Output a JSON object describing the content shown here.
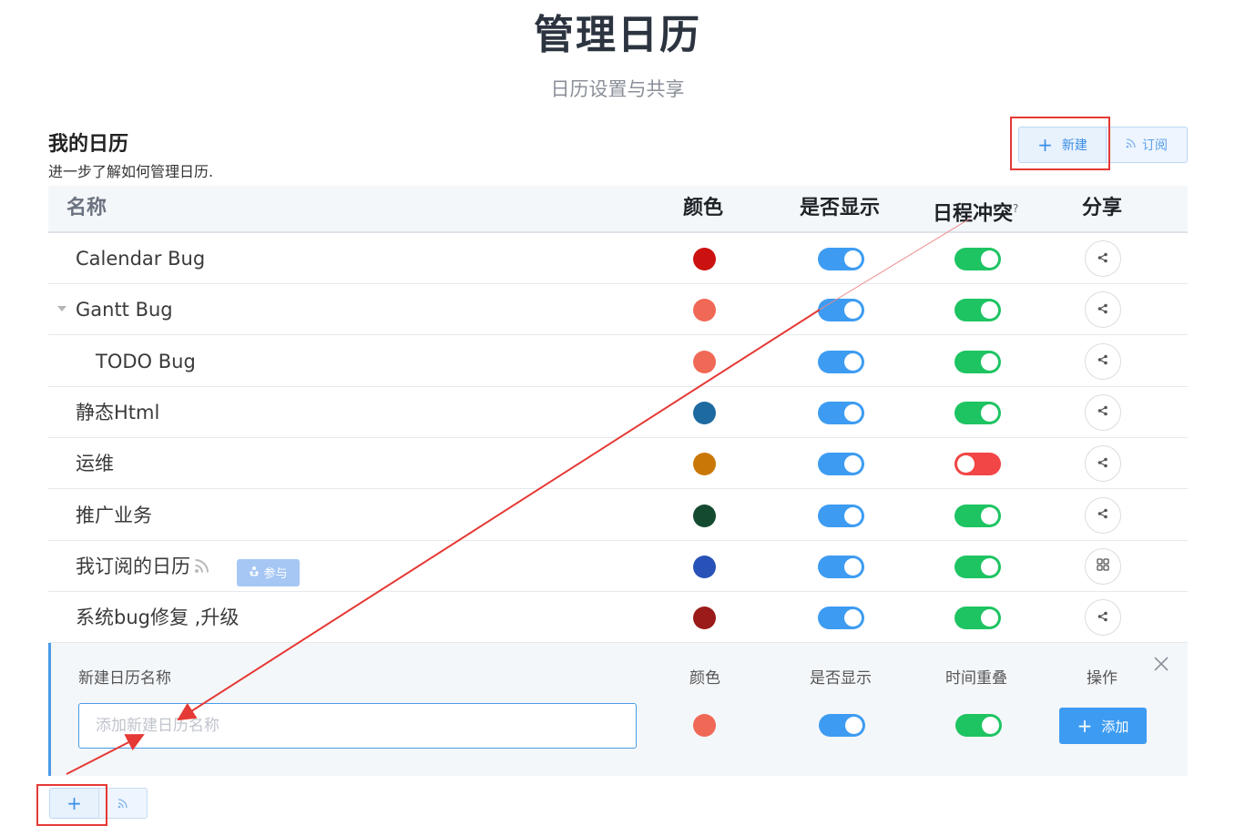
{
  "page": {
    "title": "管理日历",
    "subtitle": "日历设置与共享"
  },
  "section": {
    "title": "我的日历",
    "description": "进一步了解如何管理日历."
  },
  "toolbar": {
    "new_label": "新建",
    "subscribe_label": "订阅"
  },
  "table": {
    "headers": {
      "name": "名称",
      "color": "颜色",
      "show": "是否显示",
      "conflict": "日程冲突",
      "conflict_hint": "?",
      "share": "分享"
    },
    "rows": [
      {
        "name": "Calendar Bug",
        "color": "#cc1111",
        "show": true,
        "conflict": true,
        "share_icon": "share-icon"
      },
      {
        "name": "Gantt Bug",
        "color": "#f06856",
        "show": true,
        "conflict": true,
        "share_icon": "share-icon",
        "expanded": true
      },
      {
        "name": "TODO Bug",
        "color": "#f06856",
        "show": true,
        "conflict": true,
        "share_icon": "share-icon"
      },
      {
        "name": "静态Html",
        "color": "#1d6aa0",
        "show": true,
        "conflict": true,
        "share_icon": "share-icon"
      },
      {
        "name": "运维",
        "color": "#c97808",
        "show": true,
        "conflict": false,
        "share_icon": "share-icon"
      },
      {
        "name": "推广业务",
        "color": "#134a30",
        "show": true,
        "conflict": true,
        "share_icon": "share-icon"
      },
      {
        "name": "我订阅的日历",
        "color": "#2952b8",
        "show": true,
        "conflict": true,
        "share_icon": "grid-icon",
        "badge": "参与"
      },
      {
        "name": "系统bug修复 ,升级",
        "color": "#9b1a1a",
        "show": true,
        "conflict": true,
        "share_icon": "share-icon"
      }
    ]
  },
  "new_calendar": {
    "labels": {
      "name": "新建日历名称",
      "color": "颜色",
      "show": "是否显示",
      "overlap": "时间重叠",
      "action": "操作"
    },
    "placeholder": "添加新建日历名称",
    "value": "",
    "color": "#f06856",
    "show": true,
    "overlap": true,
    "add_label": "添加"
  },
  "bottom_buttons": {
    "plus": "+"
  },
  "colors": {
    "toggle_on_blue": "#3d9cf2",
    "toggle_on_green": "#1ec462",
    "toggle_off_red": "#f24545",
    "accent": "#3a8ee6",
    "annotation": "#e53935"
  }
}
